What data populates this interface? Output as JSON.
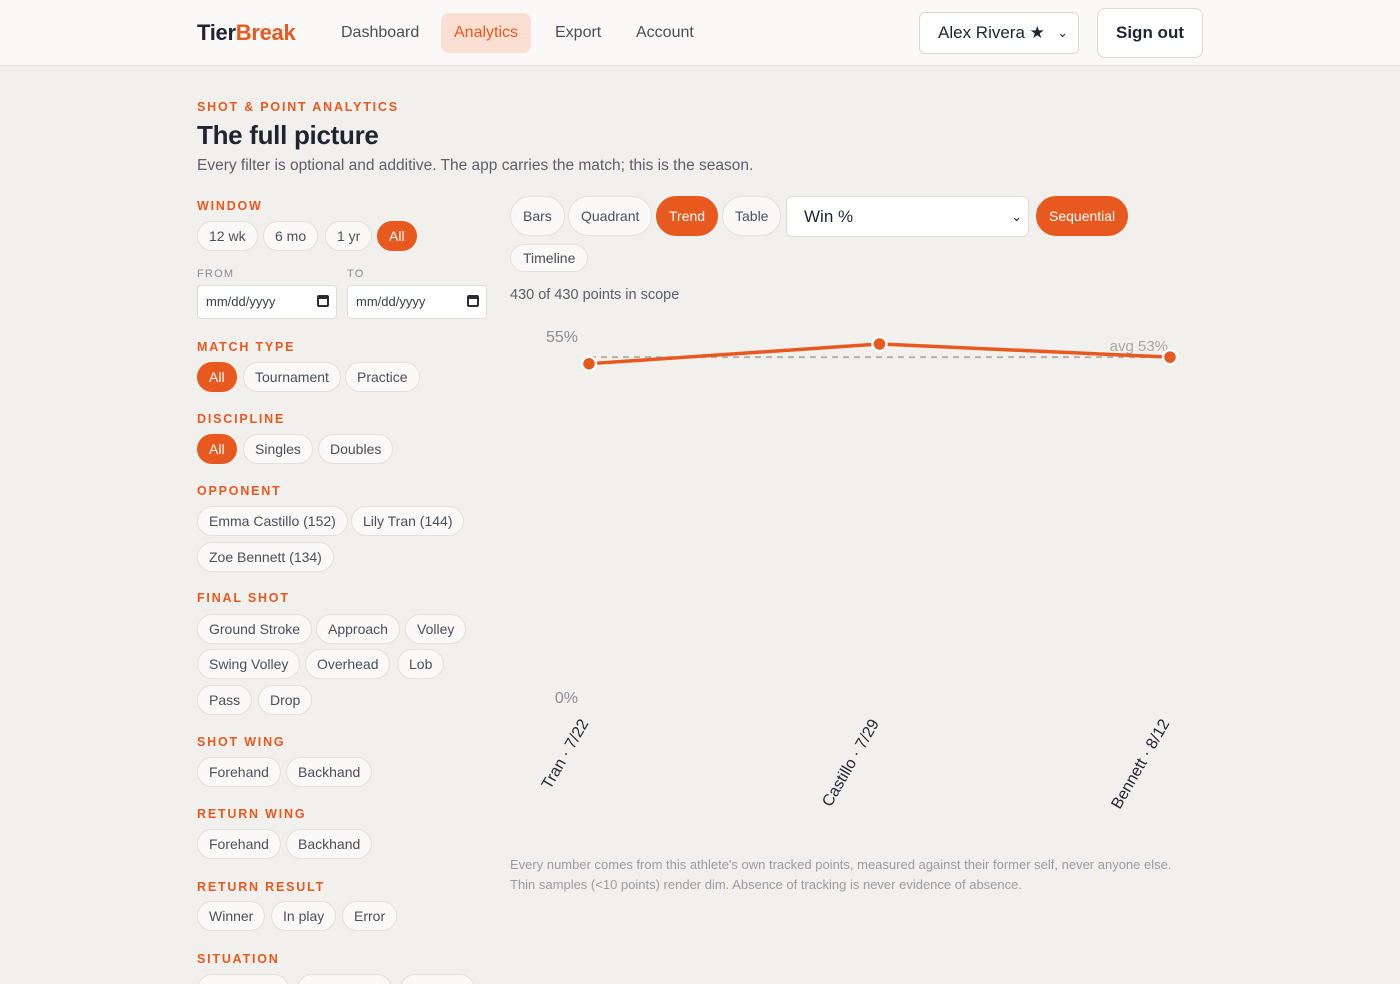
{
  "header": {
    "brand_part1": "Tier",
    "brand_part2": "Break",
    "nav": [
      "Dashboard",
      "Analytics",
      "Export",
      "Account"
    ],
    "active_nav": "Analytics",
    "user": "Alex Rivera ★",
    "sign_out": "Sign out"
  },
  "page": {
    "eyebrow": "SHOT & POINT ANALYTICS",
    "title": "The full picture",
    "subtitle": "Every filter is optional and additive. The app carries the match; this is the season."
  },
  "filters": {
    "window": {
      "label": "WINDOW",
      "options": [
        "12 wk",
        "6 mo",
        "1 yr",
        "All"
      ],
      "selected": "All"
    },
    "from_label": "FROM",
    "to_label": "TO",
    "date_placeholder": "mm/dd/yyyy",
    "match_type": {
      "label": "MATCH TYPE",
      "options": [
        "All",
        "Tournament",
        "Practice"
      ],
      "selected": "All"
    },
    "discipline": {
      "label": "DISCIPLINE",
      "options": [
        "All",
        "Singles",
        "Doubles"
      ],
      "selected": "All"
    },
    "opponent": {
      "label": "OPPONENT",
      "options": [
        "Emma Castillo (152)",
        "Lily Tran (144)",
        "Zoe Bennett (134)"
      ]
    },
    "final_shot": {
      "label": "FINAL SHOT",
      "options": [
        "Ground Stroke",
        "Approach",
        "Volley",
        "Swing Volley",
        "Overhead",
        "Lob",
        "Pass",
        "Drop"
      ]
    },
    "shot_wing": {
      "label": "SHOT WING",
      "options": [
        "Forehand",
        "Backhand"
      ]
    },
    "return_wing": {
      "label": "RETURN WING",
      "options": [
        "Forehand",
        "Backhand"
      ]
    },
    "return_result": {
      "label": "RETURN RESULT",
      "options": [
        "Winner",
        "In play",
        "Error"
      ]
    },
    "situation": {
      "label": "SITUATION"
    }
  },
  "view": {
    "tabs": [
      "Bars",
      "Quadrant",
      "Trend",
      "Table"
    ],
    "active_tab": "Trend",
    "metric": "Win %",
    "palette": "Sequential",
    "timeline": "Timeline",
    "scope": "430 of 430 points in scope"
  },
  "chart_data": {
    "type": "line",
    "x": [
      "Tran · 7/22",
      "Castillo · 7/29",
      "Bennett · 8/12"
    ],
    "series": [
      {
        "values": [
          52,
          55,
          53
        ]
      }
    ],
    "ylim": [
      0,
      55
    ],
    "y_ticks": [
      "0%",
      "55%"
    ],
    "avg_label": "avg 53%",
    "avg_value": 53,
    "colors": {
      "line": "#e8591f",
      "avg": "#b5b1ab"
    }
  },
  "footnote": "Every number comes from this athlete's own tracked points, measured against their former self, never anyone else. Thin samples (<10 points) render dim. Absence of tracking is never evidence of absence.",
  "colors": {
    "accent": "#e8591f",
    "background": "#f2f0ec"
  }
}
